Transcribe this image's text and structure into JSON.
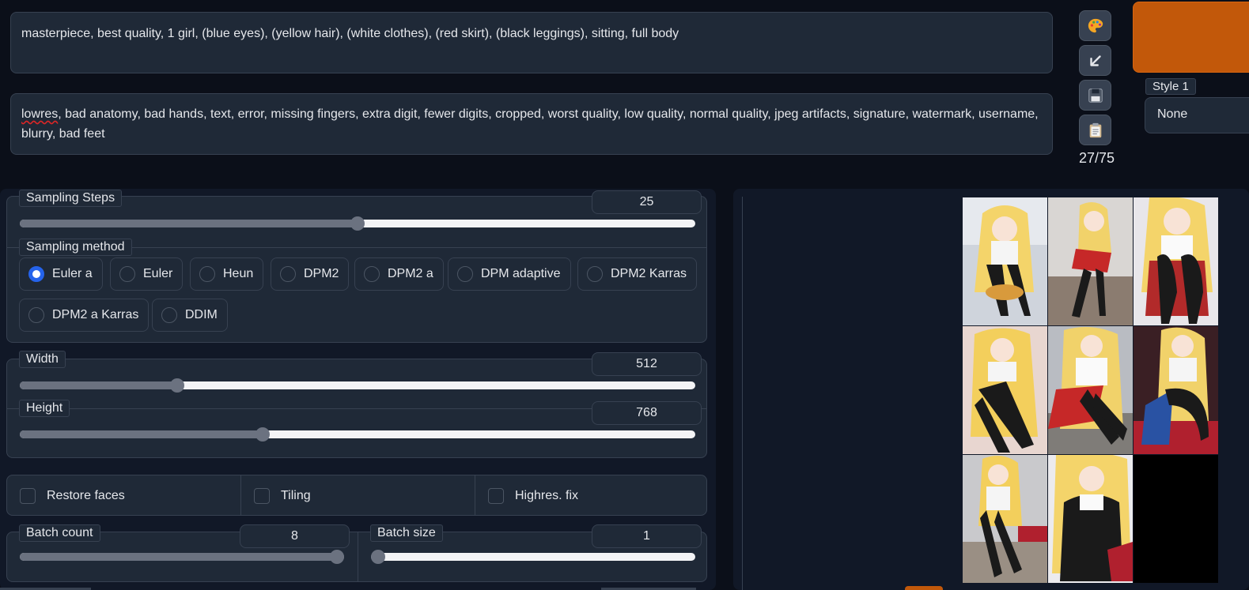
{
  "prompt": {
    "positive": "masterpiece, best quality, 1 girl, (blue eyes), (yellow hair), (white clothes), (red skirt), (black leggings), sitting, full body",
    "negative_first_word": "lowres",
    "negative_rest": ", bad anatomy, bad hands, text, error, missing fingers, extra digit, fewer digits, cropped, worst quality, low quality, normal quality, jpeg artifacts, signature, watermark, username, blurry, bad feet"
  },
  "tools": {
    "token_count": "27/75",
    "icons": [
      "palette-icon",
      "arrow-down-left-icon",
      "save-icon",
      "clipboard-icon"
    ]
  },
  "style": {
    "label": "Style 1",
    "value": "None"
  },
  "colors": {
    "accent": "#c2580a",
    "radio_selected": "#2563eb",
    "background": "#0b0f19",
    "panel": "#1f2937"
  },
  "sampling": {
    "steps_label": "Sampling Steps",
    "steps_value": "25",
    "steps_fraction": 0.5,
    "method_label": "Sampling method",
    "methods": [
      "Euler a",
      "Euler",
      "Heun",
      "DPM2",
      "DPM2 a",
      "DPM adaptive",
      "DPM2 Karras",
      "DPM2 a Karras",
      "DDIM"
    ],
    "selected_method": "Euler a"
  },
  "size": {
    "width_label": "Width",
    "width_value": "512",
    "width_fraction": 0.233,
    "height_label": "Height",
    "height_value": "768",
    "height_fraction": 0.359
  },
  "options": {
    "restore_faces": "Restore faces",
    "tiling": "Tiling",
    "highres_fix": "Highres. fix"
  },
  "batch": {
    "count_label": "Batch count",
    "count_value": "8",
    "count_fraction": 1.0,
    "size_label": "Batch size",
    "size_value": "1",
    "size_fraction": 0.0
  },
  "gallery": {
    "image_count": 8
  }
}
